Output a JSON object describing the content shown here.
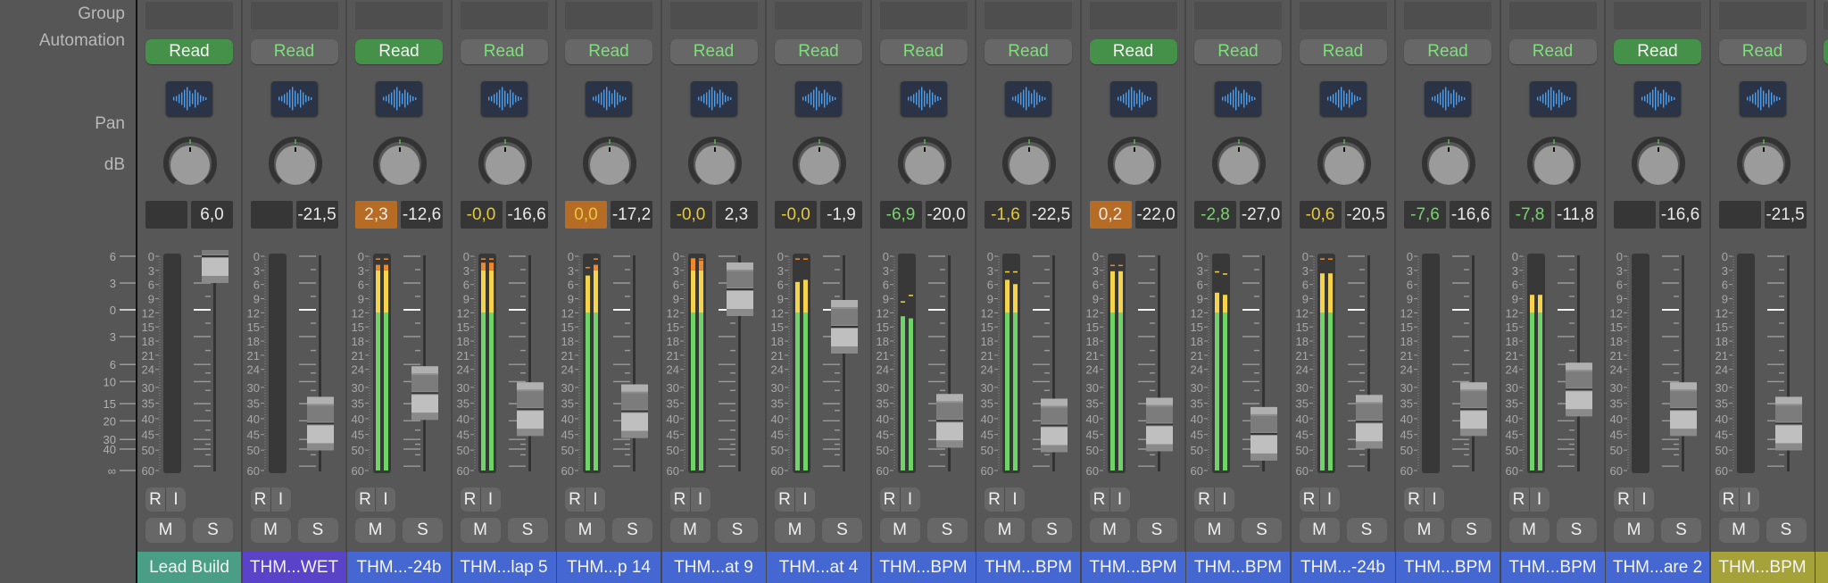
{
  "labels": {
    "group": "Group",
    "automation": "Automation",
    "pan": "Pan",
    "db": "dB"
  },
  "master_scale": [
    "6",
    "3",
    "0",
    "3",
    "6",
    "10",
    "15",
    "20",
    "30",
    "40",
    "∞"
  ],
  "meter_scale": [
    "0",
    "3",
    "6",
    "9",
    "12",
    "15",
    "18",
    "21",
    "24",
    "30",
    "35",
    "40",
    "45",
    "50",
    "60"
  ],
  "colors": {
    "auto_on_bg": "#46914a",
    "auto_off_text": "#7ee07a",
    "peak_orange": "#b76c25",
    "meter_green": "#6fd36a",
    "meter_yellow": "#f5d34a",
    "meter_orange": "#ee8a2c",
    "waveform_blue": "#4f9fef"
  },
  "buttons": {
    "rec": "R",
    "input": "I",
    "mute": "M",
    "solo": "S"
  },
  "strips": [
    {
      "name": "Lead Build",
      "color": "#4a9e86",
      "automation": "Read",
      "automation_on": true,
      "peak": "",
      "peak_style": "none",
      "volume": "6,0",
      "fader_db": 6.0,
      "meter": null
    },
    {
      "name": "THM...WET",
      "color": "#5a43c9",
      "automation": "Read",
      "automation_on": false,
      "peak": "",
      "peak_style": "none",
      "volume": "-21,5",
      "fader_db": -21.5,
      "meter": null
    },
    {
      "name": "THM...-24b",
      "color": "#4467d1",
      "automation": "Read",
      "automation_on": true,
      "peak": "2,3",
      "peak_style": "orange-white",
      "volume": "-12,6",
      "fader_db": -12.6,
      "meter": {
        "l": 0.96,
        "r": 0.96,
        "hold_l": 0.99,
        "hold_r": 0.99
      }
    },
    {
      "name": "THM...lap 5",
      "color": "#4467d1",
      "automation": "Read",
      "automation_on": false,
      "peak": "-0,0",
      "peak_style": "yellow",
      "volume": "-16,6",
      "fader_db": -16.6,
      "meter": {
        "l": 0.97,
        "r": 0.97,
        "hold_l": 0.99,
        "hold_r": 0.99
      }
    },
    {
      "name": "THM...p 14",
      "color": "#4467d1",
      "automation": "Read",
      "automation_on": false,
      "peak": "0,0",
      "peak_style": "orange-yellow",
      "volume": "-17,2",
      "fader_db": -17.2,
      "meter": {
        "l": 0.91,
        "r": 0.96,
        "hold_l": 0.95,
        "hold_r": 0.99
      }
    },
    {
      "name": "THM...at 9",
      "color": "#4467d1",
      "automation": "Read",
      "automation_on": false,
      "peak": "-0,0",
      "peak_style": "yellow",
      "volume": "2,3",
      "fader_db": 2.3,
      "meter": {
        "l": 0.99,
        "r": 0.98,
        "hold_l": 0.99,
        "hold_r": 0.99
      }
    },
    {
      "name": "THM...at 4",
      "color": "#4467d1",
      "automation": "Read",
      "automation_on": false,
      "peak": "-0,0",
      "peak_style": "yellow",
      "volume": "-1,9",
      "fader_db": -1.9,
      "meter": {
        "l": 0.88,
        "r": 0.89,
        "hold_l": 0.99,
        "hold_r": 0.99
      }
    },
    {
      "name": "THM...BPM",
      "color": "#4467d1",
      "automation": "Read",
      "automation_on": false,
      "peak": "-6,9",
      "peak_style": "green",
      "volume": "-20,0",
      "fader_db": -20.0,
      "meter": {
        "l": 0.72,
        "r": 0.71,
        "hold_l": 0.79,
        "hold_r": 0.82
      }
    },
    {
      "name": "THM...BPM",
      "color": "#4467d1",
      "automation": "Read",
      "automation_on": false,
      "peak": "-1,6",
      "peak_style": "yellow",
      "volume": "-22,5",
      "fader_db": -22.5,
      "meter": {
        "l": 0.89,
        "r": 0.87,
        "hold_l": 0.93,
        "hold_r": 0.93
      }
    },
    {
      "name": "THM...BPM",
      "color": "#4467d1",
      "automation": "Read",
      "automation_on": true,
      "peak": "0,2",
      "peak_style": "orange-white",
      "volume": "-22,0",
      "fader_db": -22.0,
      "meter": {
        "l": 0.93,
        "r": 0.93,
        "hold_l": 0.96,
        "hold_r": 0.96
      }
    },
    {
      "name": "THM...BPM",
      "color": "#4467d1",
      "automation": "Read",
      "automation_on": false,
      "peak": "-2,8",
      "peak_style": "green",
      "volume": "-27,0",
      "fader_db": -27.0,
      "meter": {
        "l": 0.83,
        "r": 0.82,
        "hold_l": 0.93,
        "hold_r": 0.92
      }
    },
    {
      "name": "THM...-24b",
      "color": "#4467d1",
      "automation": "Read",
      "automation_on": false,
      "peak": "-0,6",
      "peak_style": "yellow",
      "volume": "-20,5",
      "fader_db": -20.5,
      "meter": {
        "l": 0.92,
        "r": 0.92,
        "hold_l": 0.99,
        "hold_r": 0.99
      }
    },
    {
      "name": "THM...BPM",
      "color": "#4467d1",
      "automation": "Read",
      "automation_on": false,
      "peak": "-7,6",
      "peak_style": "green",
      "volume": "-16,6",
      "fader_db": -16.6,
      "meter": null
    },
    {
      "name": "THM...BPM",
      "color": "#4467d1",
      "automation": "Read",
      "automation_on": false,
      "peak": "-7,8",
      "peak_style": "green",
      "volume": "-11,8",
      "fader_db": -11.8,
      "meter": {
        "l": 0.82,
        "r": 0.82,
        "hold_l": null,
        "hold_r": null
      }
    },
    {
      "name": "THM...are 2",
      "color": "#4467d1",
      "automation": "Read",
      "automation_on": true,
      "peak": "",
      "peak_style": "none",
      "volume": "-16,6",
      "fader_db": -16.6,
      "meter": null
    },
    {
      "name": "THM...BPM",
      "color": "#a6a23a",
      "automation": "Read",
      "automation_on": false,
      "peak": "",
      "peak_style": "none",
      "volume": "-21,5",
      "fader_db": -21.5,
      "meter": null
    },
    {
      "name": "",
      "color": "#a6a23a",
      "automation": "",
      "automation_on": true,
      "peak": "",
      "peak_style": "none",
      "volume": "",
      "fader_db": null,
      "meter": null
    }
  ]
}
